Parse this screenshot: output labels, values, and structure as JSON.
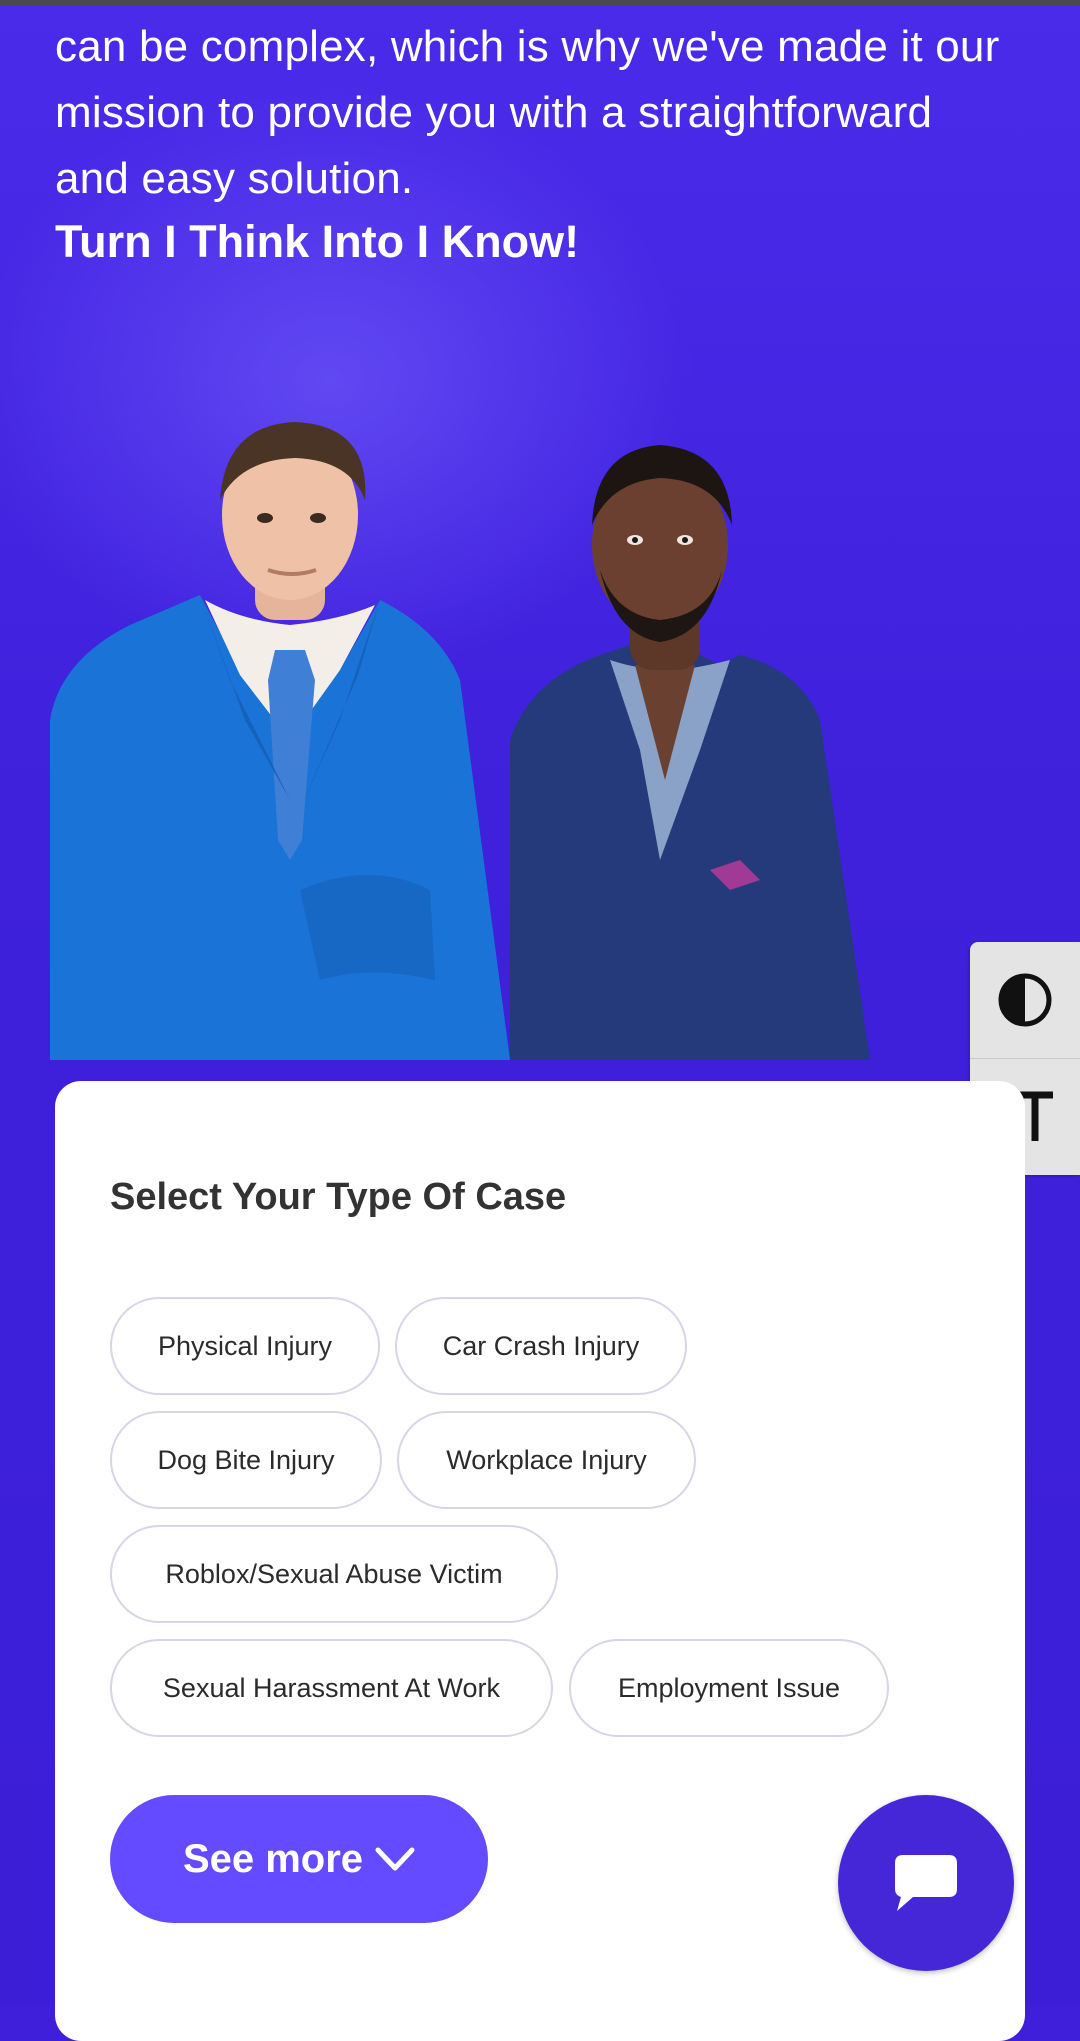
{
  "hero": {
    "intro_text": "can be complex, which is why we've made it our mission to provide you with a straightforward and easy solution.",
    "tagline": "Turn I Think Into I Know!"
  },
  "accessibility": {
    "contrast_icon": "contrast-icon",
    "text_size_icon": "text-size-icon"
  },
  "case_selector": {
    "title": "Select Your Type Of Case",
    "options": [
      "Physical Injury",
      "Car Crash Injury",
      "Dog Bite Injury",
      "Workplace Injury",
      "Roblox/Sexual Abuse Victim",
      "Sexual Harassment At Work",
      "Employment Issue"
    ],
    "see_more_label": "See more"
  },
  "chat": {
    "icon": "chat-bubble-icon"
  },
  "colors": {
    "hero_background": "#3f1fd9",
    "accent_button": "#644bff",
    "chat_button": "#4527d8",
    "card_background": "#ffffff"
  }
}
